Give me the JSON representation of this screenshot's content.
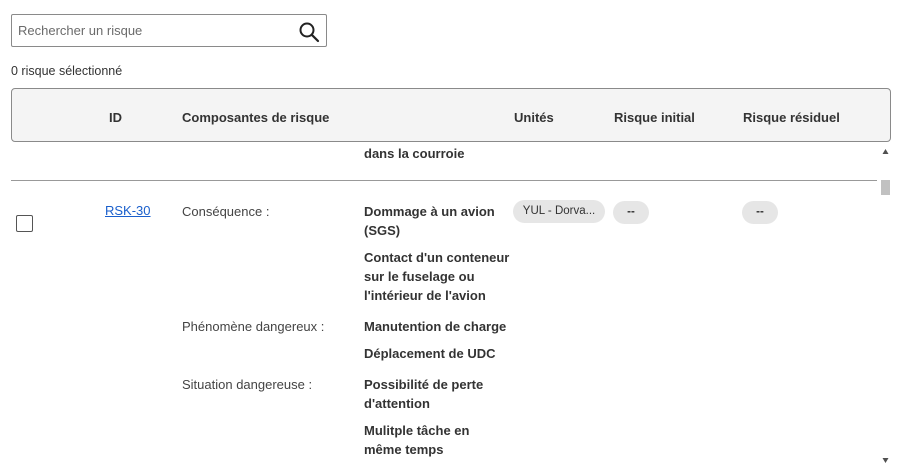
{
  "search": {
    "placeholder": "Rechercher un risque",
    "value": ""
  },
  "selection": {
    "count_text": "0 risque sélectionné"
  },
  "table": {
    "columns": {
      "id": "ID",
      "components": "Composantes de risque",
      "units": "Unités",
      "initial_risk": "Risque initial",
      "residual_risk": "Risque résiduel"
    },
    "prev_row_tail": "dans la courroie",
    "row": {
      "id": "RSK-30",
      "unit_pill": "YUL - Dorva...",
      "initial_risk": "--",
      "residual_risk": "--",
      "consequence_label": "Conséquence :",
      "consequence_1a": "Dommage à un avion",
      "consequence_1b": "(SGS)",
      "consequence_2a": "Contact d'un conteneur",
      "consequence_2b": "sur le fuselage ou",
      "consequence_2c": "l'intérieur de l'avion",
      "phenomenon_label": "Phénomène dangereux :",
      "phenomenon_1": "Manutention de charge",
      "phenomenon_2": "Déplacement de UDC",
      "situation_label": "Situation dangereuse :",
      "situation_1a": "Possibilité de perte",
      "situation_1b": "d'attention",
      "situation_2a": "Mulitple tâche en",
      "situation_2b": "même temps"
    }
  },
  "colors": {
    "link": "#1a5fcc",
    "pill_background": "#e6e6e6",
    "header_background": "#f4f4f4"
  }
}
